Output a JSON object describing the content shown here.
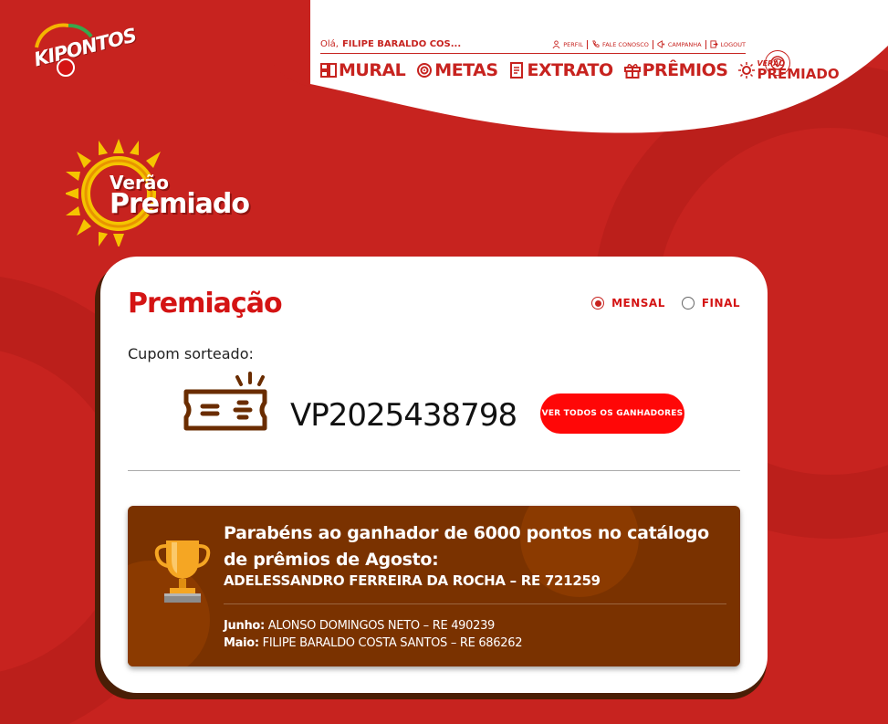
{
  "brand": {
    "logo_text": "KIPONTOS",
    "primary_color": "#c7231f",
    "dark_brown": "#7a3200",
    "button_red": "#ff0707"
  },
  "header": {
    "greeting": "Olá,",
    "user_name": "FILIPE BARALDO COS...",
    "top_links": [
      {
        "label": "PERFIL",
        "icon": "user-icon"
      },
      {
        "label": "FALE CONOSCO",
        "icon": "phone-icon"
      },
      {
        "label": "CAMPANHA",
        "icon": "megaphone-icon"
      },
      {
        "label": "LOGOUT",
        "icon": "logout-icon"
      }
    ],
    "nav": [
      {
        "label": "MURAL",
        "icon": "mural-icon"
      },
      {
        "label": "METAS",
        "icon": "target-icon"
      },
      {
        "label": "EXTRATO",
        "icon": "receipt-icon"
      },
      {
        "label": "PRÊMIOS",
        "icon": "gift-icon"
      }
    ],
    "nav_verao": {
      "small": "VERÃO",
      "big": "PREMIADO"
    }
  },
  "hero_logo": {
    "line1": "Verão",
    "line2": "Premiado"
  },
  "card": {
    "title": "Premiação",
    "radio_options": [
      {
        "label": "MENSAL",
        "selected": true
      },
      {
        "label": "FINAL",
        "selected": false
      }
    ],
    "coupon_label": "Cupom sorteado:",
    "coupon_code": "VP2025438798",
    "winners_button": "VER TODOS OS GANHADORES",
    "winner": {
      "headline": "Parabéns ao ganhador de 6000 pontos no catálogo de prêmios de Agosto:",
      "name": "ADELESSANDRO FERREIRA DA ROCHA – RE 721259",
      "previous": [
        {
          "month": "Junho:",
          "name": "ALONSO DOMINGOS NETO – RE 490239"
        },
        {
          "month": "Maio:",
          "name": "FILIPE BARALDO COSTA SANTOS – RE 686262"
        }
      ]
    }
  }
}
